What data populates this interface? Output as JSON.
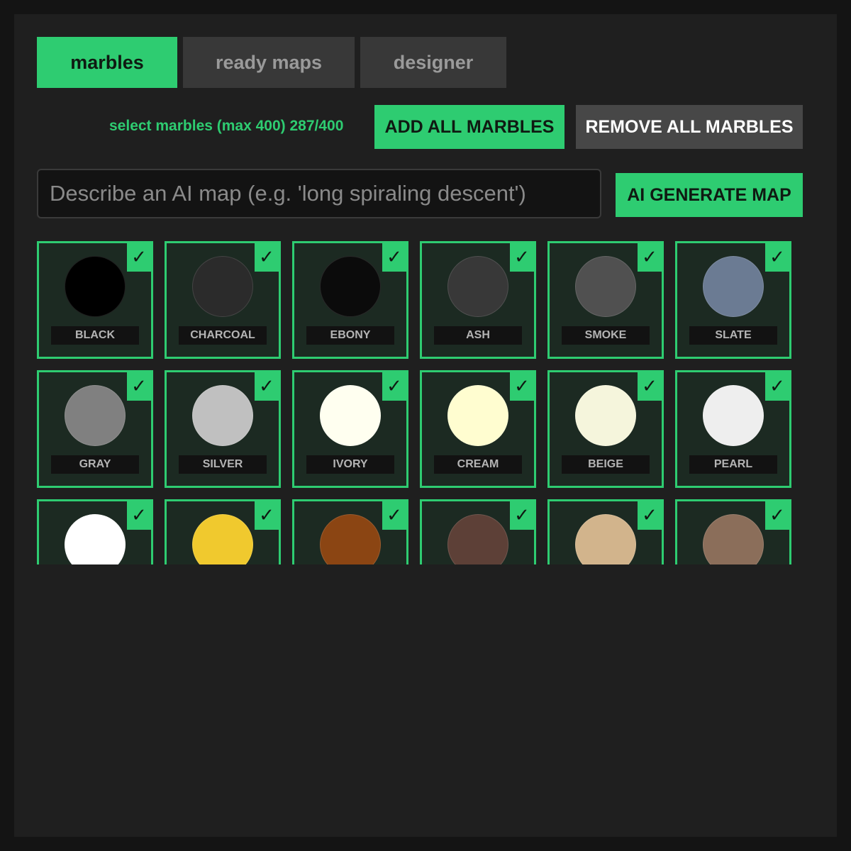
{
  "tabs": [
    {
      "label": "marbles",
      "active": true
    },
    {
      "label": "ready maps",
      "active": false
    },
    {
      "label": "designer",
      "active": false
    }
  ],
  "toolbar": {
    "selection_label": "select marbles (max 400) 287/400",
    "add_all_label": "ADD ALL MARBLES",
    "remove_all_label": "REMOVE ALL MARBLES"
  },
  "ai": {
    "placeholder": "Describe an AI map (e.g. 'long spiraling descent')",
    "value": "",
    "generate_label": "AI GENERATE MAP"
  },
  "check_glyph": "✓",
  "colors": {
    "accent": "#2ecc71",
    "card_bg": "#1c2a22",
    "panel_bg": "#1f1f1f"
  },
  "marbles": [
    {
      "name": "BLACK",
      "color": "#000000",
      "selected": true
    },
    {
      "name": "CHARCOAL",
      "color": "#2b2b2b",
      "selected": true
    },
    {
      "name": "EBONY",
      "color": "#0b0b0b",
      "selected": true
    },
    {
      "name": "ASH",
      "color": "#383838",
      "selected": true
    },
    {
      "name": "SMOKE",
      "color": "#505050",
      "selected": true
    },
    {
      "name": "SLATE",
      "color": "#6b7b93",
      "selected": true
    },
    {
      "name": "GRAY",
      "color": "#808080",
      "selected": true
    },
    {
      "name": "SILVER",
      "color": "#c0c0c0",
      "selected": true
    },
    {
      "name": "IVORY",
      "color": "#fffff0",
      "selected": true
    },
    {
      "name": "CREAM",
      "color": "#fffdd0",
      "selected": true
    },
    {
      "name": "BEIGE",
      "color": "#f5f5dc",
      "selected": true
    },
    {
      "name": "PEARL",
      "color": "#eeeeee",
      "selected": true
    },
    {
      "name": "",
      "color": "#ffffff",
      "selected": true
    },
    {
      "name": "",
      "color": "#f0c92e",
      "selected": true
    },
    {
      "name": "",
      "color": "#8b4513",
      "selected": true
    },
    {
      "name": "",
      "color": "#5d4037",
      "selected": true
    },
    {
      "name": "",
      "color": "#d2b48c",
      "selected": true
    },
    {
      "name": "",
      "color": "#8b6e5a",
      "selected": true
    }
  ]
}
